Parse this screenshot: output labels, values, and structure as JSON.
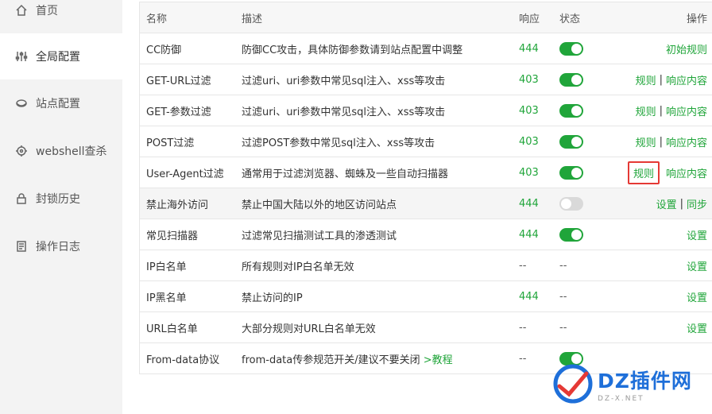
{
  "sidebar": {
    "items": [
      {
        "label": "首页",
        "icon": "home-icon"
      },
      {
        "label": "全局配置",
        "icon": "sliders-icon"
      },
      {
        "label": "站点配置",
        "icon": "globe-icon"
      },
      {
        "label": "webshell查杀",
        "icon": "target-icon"
      },
      {
        "label": "封锁历史",
        "icon": "lock-icon"
      },
      {
        "label": "操作日志",
        "icon": "document-icon"
      }
    ]
  },
  "table": {
    "headers": {
      "name": "名称",
      "desc": "描述",
      "resp": "响应",
      "status": "状态",
      "ops": "操作"
    },
    "rows": [
      {
        "name": "CC防御",
        "desc": "防御CC攻击，具体防御参数请到站点配置中调整",
        "resp": "444",
        "status": "on",
        "ops": [
          "初始规则"
        ]
      },
      {
        "name": "GET-URL过滤",
        "desc": "过滤uri、uri参数中常见sql注入、xss等攻击",
        "resp": "403",
        "status": "on",
        "ops": [
          "规则",
          "响应内容"
        ]
      },
      {
        "name": "GET-参数过滤",
        "desc": "过滤uri、uri参数中常见sql注入、xss等攻击",
        "resp": "403",
        "status": "on",
        "ops": [
          "规则",
          "响应内容"
        ]
      },
      {
        "name": "POST过滤",
        "desc": "过滤POST参数中常见sql注入、xss等攻击",
        "resp": "403",
        "status": "on",
        "ops": [
          "规则",
          "响应内容"
        ]
      },
      {
        "name": "User-Agent过滤",
        "desc": "通常用于过滤浏览器、蜘蛛及一些自动扫描器",
        "resp": "403",
        "status": "on",
        "ops": [
          "规则",
          "响应内容"
        ]
      },
      {
        "name": "禁止海外访问",
        "desc": "禁止中国大陆以外的地区访问站点",
        "resp": "444",
        "status": "off",
        "ops": [
          "设置",
          "同步"
        ]
      },
      {
        "name": "常见扫描器",
        "desc": "过滤常见扫描测试工具的渗透测试",
        "resp": "444",
        "status": "on",
        "ops": [
          "设置"
        ]
      },
      {
        "name": "IP白名单",
        "desc": "所有规则对IP白名单无效",
        "resp": "--",
        "status": "--",
        "ops": [
          "设置"
        ]
      },
      {
        "name": "IP黑名单",
        "desc": "禁止访问的IP",
        "resp": "444",
        "status": "--",
        "ops": [
          "设置"
        ]
      },
      {
        "name": "URL白名单",
        "desc": "大部分规则对URL白名单无效",
        "resp": "--",
        "status": "--",
        "ops": [
          "设置"
        ]
      },
      {
        "name": "From-data协议",
        "desc": "from-data传参规范开关/建议不要关闭",
        "desc_link": ">教程",
        "resp": "--",
        "status": "on",
        "ops": []
      }
    ]
  },
  "watermark": {
    "main": "DZ插件网",
    "sub": "DZ-X.NET"
  },
  "colors": {
    "accent": "#20a53a",
    "highlight_border": "#e53935",
    "watermark_blue": "#1e6fd9"
  }
}
